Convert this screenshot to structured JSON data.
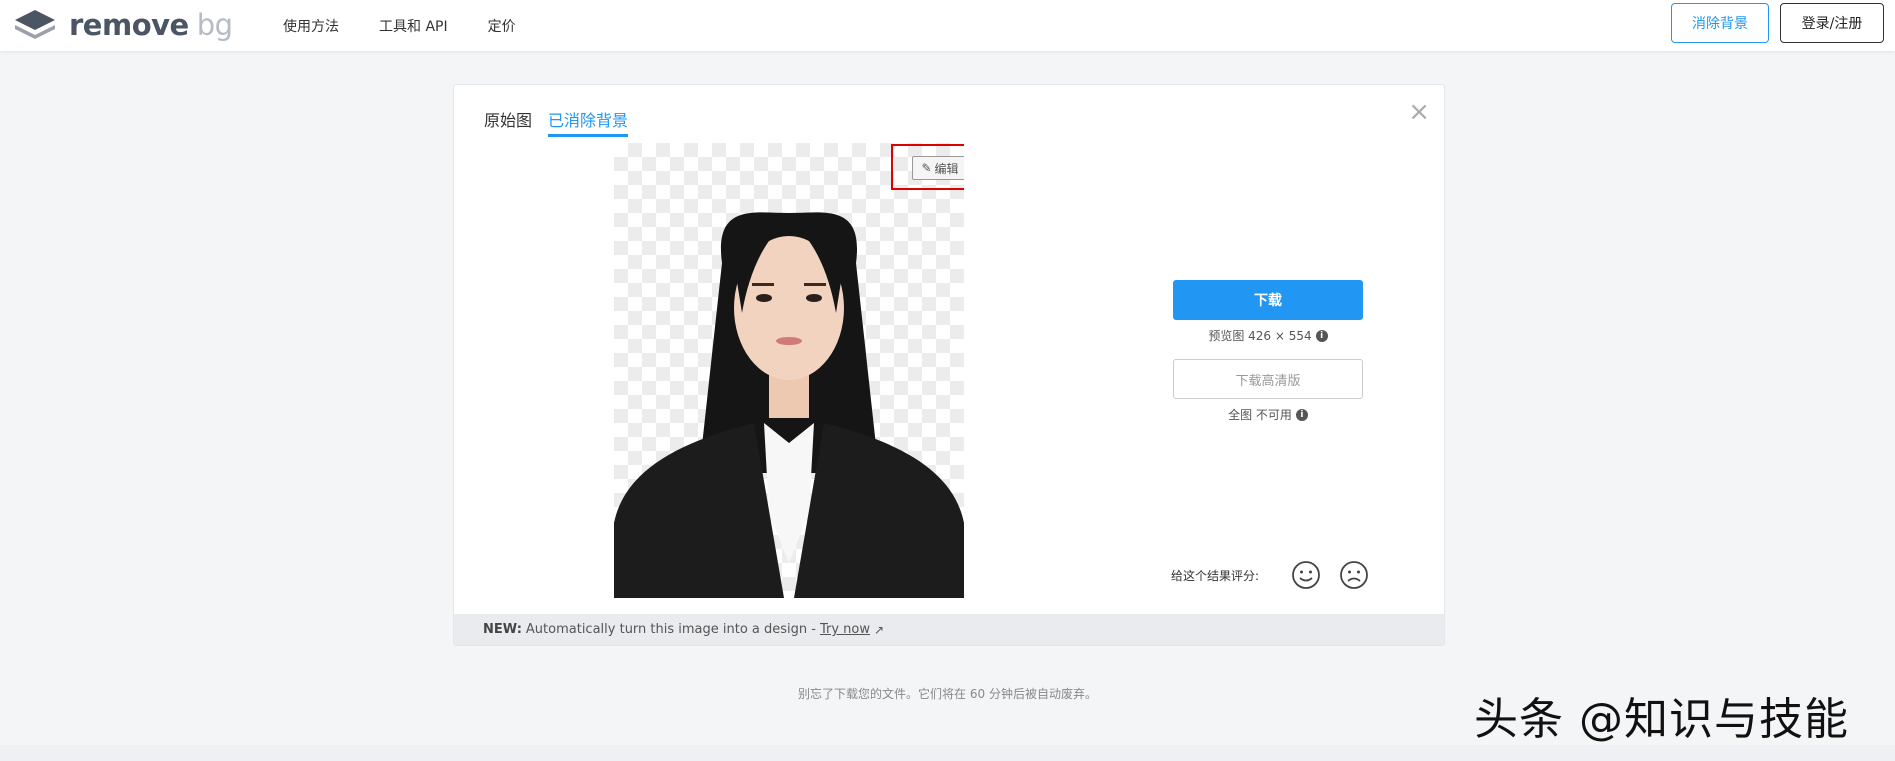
{
  "header": {
    "logo_word": "remove",
    "logo_word2": "bg",
    "nav": [
      "使用方法",
      "工具和 API",
      "定价"
    ],
    "remove_bg_button": "消除背景",
    "login_button": "登录/注册"
  },
  "card": {
    "tabs": [
      "原始图",
      "已消除背景"
    ],
    "active_tab": "已消除背景",
    "close_glyph": "×",
    "edit_button": "编辑",
    "download_button": "下载",
    "preview_info": "预览图 426 × 554",
    "hd_button": "下载高清版",
    "hd_info": "全图 不可用",
    "rating_label": "给这个结果评分:",
    "new_label": "NEW:",
    "new_text": "Automatically turn this image into a design -",
    "try_now": "Try now"
  },
  "bottom_note": "别忘了下载您的文件。它们将在 60 分钟后被自动废弃。",
  "watermark": "头条 @知识与技能",
  "colors": {
    "accent": "#2196f3",
    "highlight_box": "#e00000"
  }
}
